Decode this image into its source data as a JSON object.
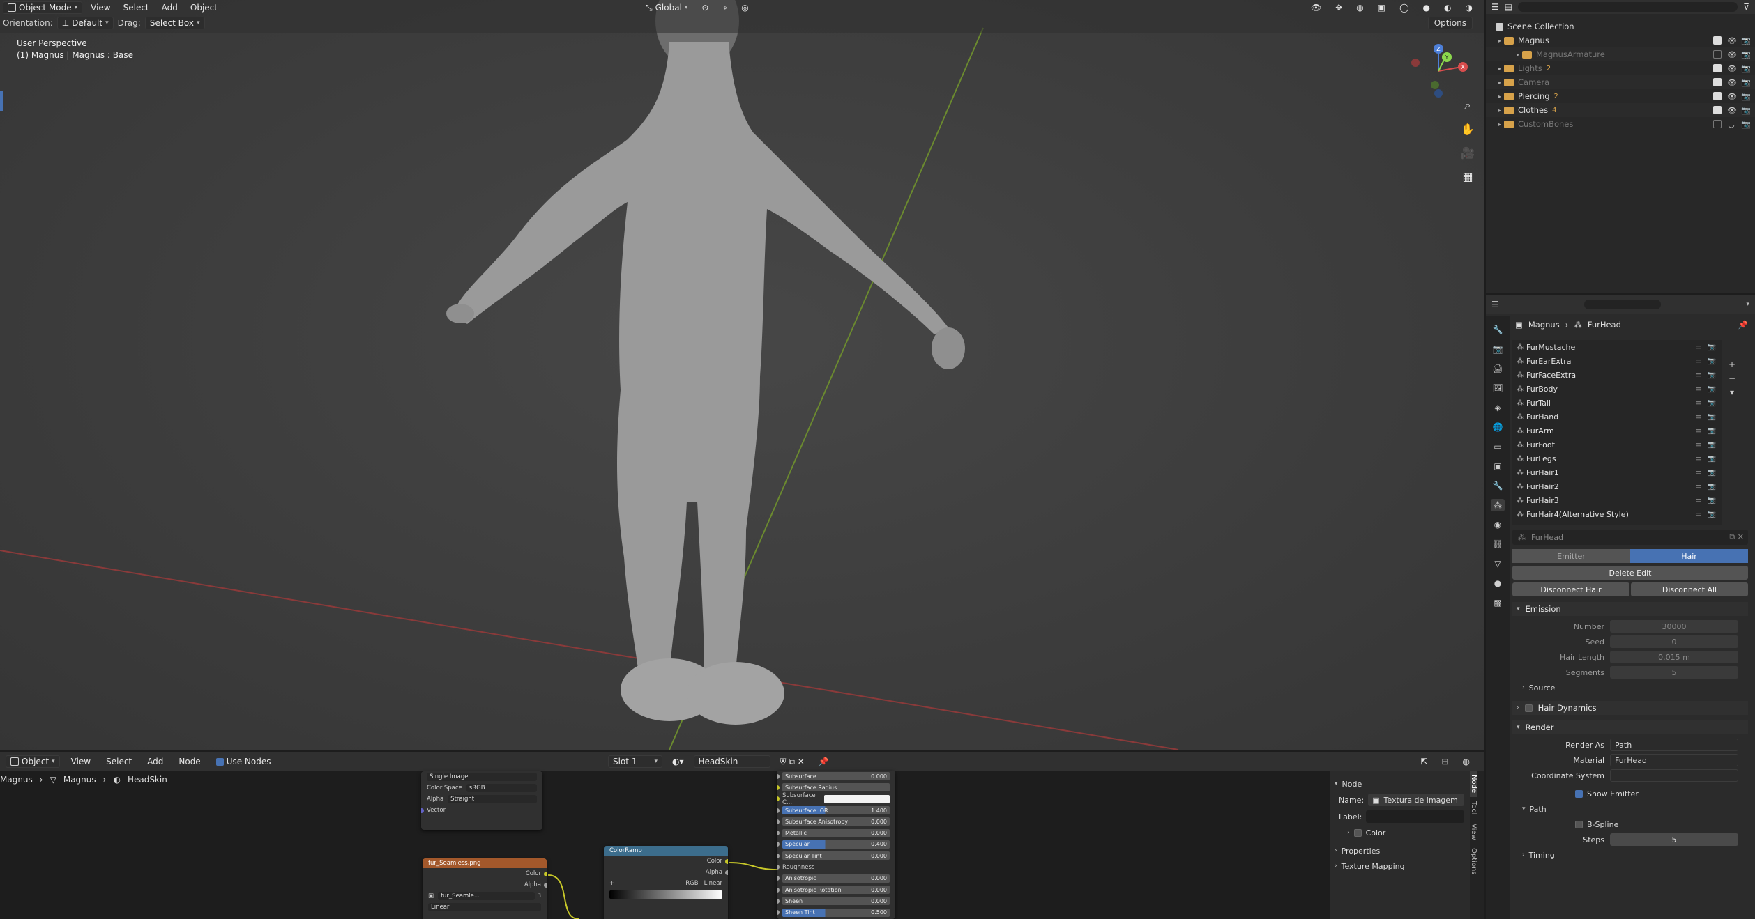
{
  "viewport": {
    "mode": "Object Mode",
    "menus": [
      "View",
      "Select",
      "Add",
      "Object"
    ],
    "orientation_label": "Orientation:",
    "orientation_value": "Default",
    "drag_label": "Drag:",
    "drag_value": "Select Box",
    "transform_space": "Global",
    "options_label": "Options",
    "perspective": "User Perspective",
    "object_info": "(1) Magnus | Magnus : Base",
    "gizmo_axes": {
      "x": "X",
      "y": "Y",
      "z": "Z"
    }
  },
  "outliner": {
    "root": "Scene Collection",
    "items": [
      {
        "name": "Magnus",
        "color": "#d7a24a",
        "checked": true,
        "visible": true,
        "dim": false
      },
      {
        "name": "MagnusArmature",
        "color": "#d7a24a",
        "checked": false,
        "visible": true,
        "dim": true
      },
      {
        "name": "Lights",
        "color": "#d7a24a",
        "checked": true,
        "visible": true,
        "dim": true,
        "count": "2"
      },
      {
        "name": "Camera",
        "color": "#d7a24a",
        "checked": true,
        "visible": true,
        "dim": true
      },
      {
        "name": "Piercing",
        "color": "#d7a24a",
        "checked": true,
        "visible": true,
        "dim": false,
        "count": "2"
      },
      {
        "name": "Clothes",
        "color": "#d7a24a",
        "checked": true,
        "visible": true,
        "dim": false,
        "count": "4"
      },
      {
        "name": "CustomBones",
        "color": "#d7a24a",
        "checked": false,
        "visible": false,
        "dim": true
      }
    ]
  },
  "properties": {
    "breadcrumb": [
      "Magnus",
      "FurHead"
    ],
    "particle_systems": [
      "FurMustache",
      "FurEarExtra",
      "FurFaceExtra",
      "FurBody",
      "FurTail",
      "FurHand",
      "FurArm",
      "FurFoot",
      "FurLegs",
      "FurHair1",
      "FurHair2",
      "FurHair3",
      "FurHair4(Alternative Style)"
    ],
    "active_system": "FurHead",
    "type_tabs": [
      "Emitter",
      "Hair"
    ],
    "delete_edit": "Delete Edit",
    "disconnect_hair": "Disconnect Hair",
    "disconnect_all": "Disconnect All",
    "emission": {
      "title": "Emission",
      "number_label": "Number",
      "number": "30000",
      "seed_label": "Seed",
      "seed": "0",
      "hair_length_label": "Hair Length",
      "hair_length": "0.015 m",
      "segments_label": "Segments",
      "segments": "5"
    },
    "source_label": "Source",
    "hair_dynamics_label": "Hair Dynamics",
    "render": {
      "title": "Render",
      "render_as_label": "Render As",
      "render_as": "Path",
      "material_label": "Material",
      "material": "FurHead",
      "coord_label": "Coordinate System",
      "show_emitter": "Show Emitter",
      "path_label": "Path",
      "bspline": "B-Spline",
      "steps_label": "Steps",
      "steps": "5"
    },
    "timing_label": "Timing"
  },
  "node_editor": {
    "object_mode": "Object",
    "menus": [
      "View",
      "Select",
      "Add",
      "Node"
    ],
    "use_nodes": "Use Nodes",
    "slot": "Slot 1",
    "material": "HeadSkin",
    "crumbs": [
      "Magnus",
      "Magnus",
      "HeadSkin"
    ],
    "image_node": {
      "source": "Single Image",
      "color_space_label": "Color Space",
      "color_space": "sRGB",
      "alpha_label": "Alpha",
      "alpha": "Straight",
      "vector": "Vector"
    },
    "texture_node": {
      "title": "fur_Seamless.png",
      "color": "Color",
      "alpha": "Alpha",
      "file": "fur_Seamle...",
      "users": "3",
      "interp": "Linear"
    },
    "colorramp": {
      "title": "ColorRamp",
      "color": "Color",
      "alpha": "Alpha",
      "mode": "RGB",
      "interp": "Linear"
    },
    "bsdf_rows": [
      {
        "label": "Subsurface",
        "value": "0.000",
        "kind": "slider"
      },
      {
        "label": "Subsurface Radius",
        "value": "",
        "kind": "drop"
      },
      {
        "label": "Subsurface C...",
        "value": "",
        "kind": "white"
      },
      {
        "label": "Subsurface IOR",
        "value": "1.400",
        "kind": "blue"
      },
      {
        "label": "Subsurface Anisotropy",
        "value": "0.000",
        "kind": "slider"
      },
      {
        "label": "Metallic",
        "value": "0.000",
        "kind": "slider"
      },
      {
        "label": "Specular",
        "value": "0.400",
        "kind": "blue"
      },
      {
        "label": "Specular Tint",
        "value": "0.000",
        "kind": "slider"
      },
      {
        "label": "Roughness",
        "value": "",
        "kind": "label"
      },
      {
        "label": "Anisotropic",
        "value": "0.000",
        "kind": "slider"
      },
      {
        "label": "Anisotropic Rotation",
        "value": "0.000",
        "kind": "slider"
      },
      {
        "label": "Sheen",
        "value": "0.000",
        "kind": "slider"
      },
      {
        "label": "Sheen Tint",
        "value": "0.500",
        "kind": "blue"
      }
    ],
    "sidebar": {
      "title": "Node",
      "name_label": "Name:",
      "name": "Textura de imagem",
      "label_label": "Label:",
      "color_label": "Color",
      "properties_label": "Properties",
      "mapping_label": "Texture Mapping",
      "tabs": [
        "Node",
        "Tool",
        "View",
        "Options"
      ]
    }
  }
}
